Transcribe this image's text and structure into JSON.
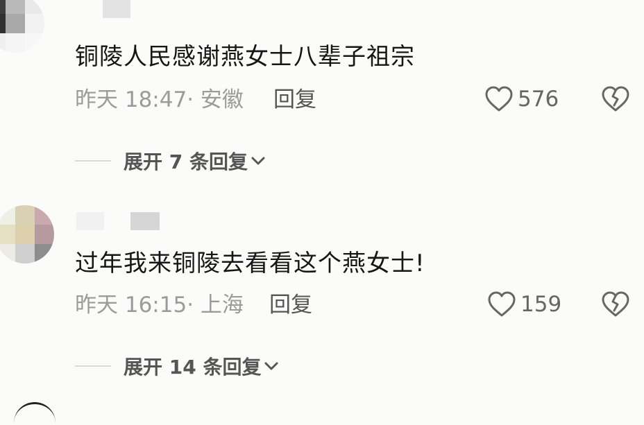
{
  "comments": [
    {
      "text": "铜陵人民感谢燕女士八辈子祖宗",
      "time": "昨天 18:47",
      "location": "· 安徽",
      "reply_label": "回复",
      "likes": "576",
      "expand_label": "展开 7 条回复"
    },
    {
      "text": "过年我来铜陵去看看这个燕女士!",
      "time": "昨天 16:15",
      "location": "· 上海",
      "reply_label": "回复",
      "likes": "159",
      "expand_label": "展开 14 条回复"
    }
  ],
  "colors": {
    "background": "#fbfbf9",
    "text": "#161616",
    "meta": "#9b9b9b",
    "icon": "#666666"
  }
}
